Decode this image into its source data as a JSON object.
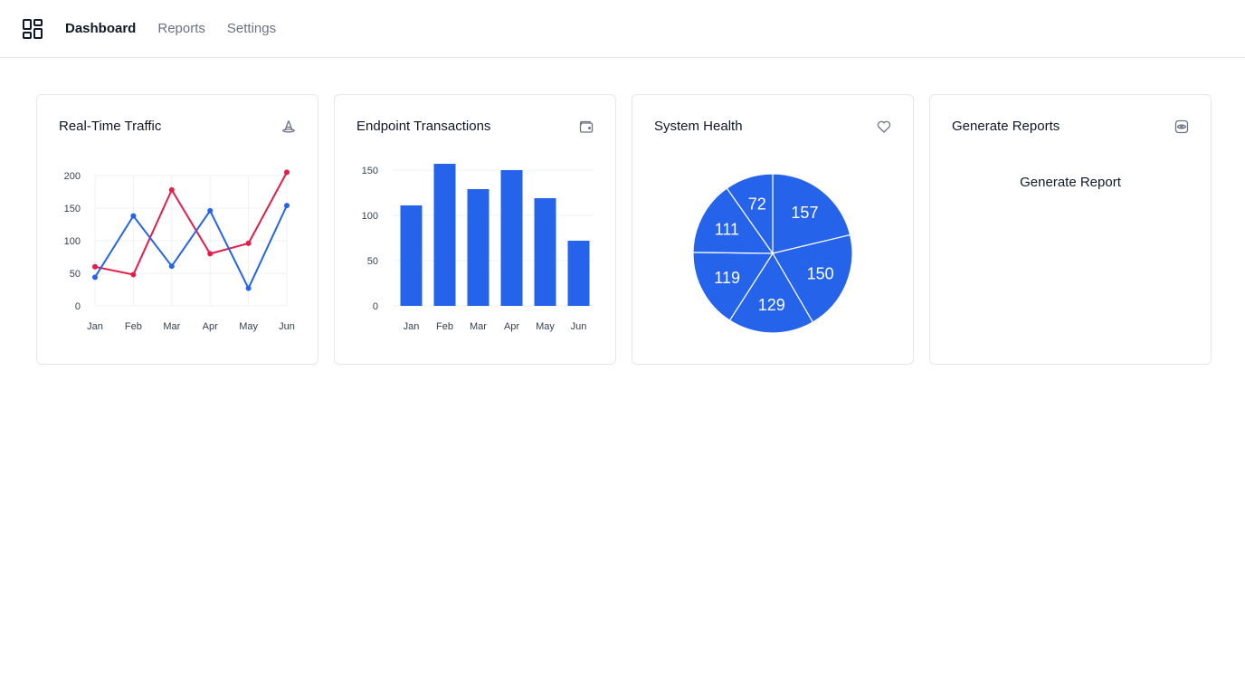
{
  "nav": {
    "items": [
      {
        "label": "Dashboard",
        "active": true
      },
      {
        "label": "Reports",
        "active": false
      },
      {
        "label": "Settings",
        "active": false
      }
    ]
  },
  "cards": {
    "traffic": {
      "title": "Real-Time Traffic",
      "icon": "traffic-cone-icon"
    },
    "transactions": {
      "title": "Endpoint Transactions",
      "icon": "wallet-icon"
    },
    "health": {
      "title": "System Health",
      "icon": "heart-icon"
    },
    "reports": {
      "title": "Generate Reports",
      "icon": "eye-icon",
      "button_label": "Generate Report"
    }
  },
  "colors": {
    "blue": "#2563eb",
    "red": "#e11d48",
    "grid": "#eef0f3",
    "axis_text": "#374151"
  },
  "chart_data": [
    {
      "type": "line",
      "categories": [
        "Jan",
        "Feb",
        "Mar",
        "Apr",
        "May",
        "Jun"
      ],
      "series": [
        {
          "values": [
            60,
            48,
            178,
            80,
            96,
            205
          ],
          "color": "#e11d48"
        },
        {
          "values": [
            44,
            138,
            61,
            146,
            27,
            154
          ],
          "color": "#2563eb"
        }
      ],
      "yticks": [
        0,
        50,
        100,
        150,
        200
      ],
      "ylim": [
        0,
        200
      ],
      "grid": true
    },
    {
      "type": "bar",
      "categories": [
        "Jan",
        "Feb",
        "Mar",
        "Apr",
        "May",
        "Jun"
      ],
      "values": [
        111,
        157,
        129,
        150,
        119,
        72
      ],
      "yticks": [
        0,
        50,
        100,
        150
      ],
      "ylim": [
        0,
        150
      ],
      "color": "#2563eb",
      "grid": true
    },
    {
      "type": "pie",
      "values": [
        157,
        150,
        129,
        119,
        111,
        72
      ],
      "color": "#2563eb"
    }
  ]
}
